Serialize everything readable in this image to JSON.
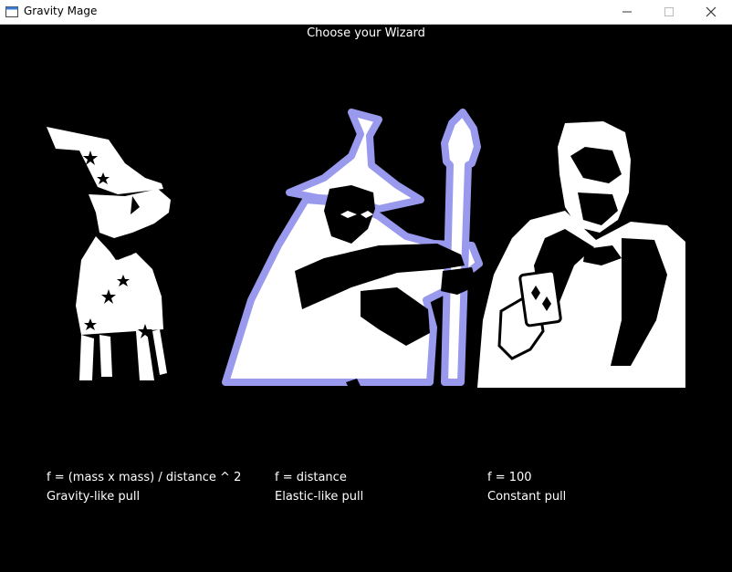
{
  "window": {
    "title": "Gravity Mage"
  },
  "heading": "Choose your Wizard",
  "selected_wizard": "elastic",
  "colors": {
    "background": "#000000",
    "text": "#ffffff",
    "selection_outline": "#9999ee"
  },
  "wizards": [
    {
      "id": "gravity",
      "icon": "dog-wizard-icon",
      "formula": "f = (mass x mass) / distance ^ 2",
      "label": "Gravity-like pull"
    },
    {
      "id": "elastic",
      "icon": "staff-wizard-icon",
      "formula": "f = distance",
      "label": "Elastic-like pull"
    },
    {
      "id": "constant",
      "icon": "card-magician-icon",
      "formula": "f = 100",
      "label": "Constant pull"
    }
  ]
}
